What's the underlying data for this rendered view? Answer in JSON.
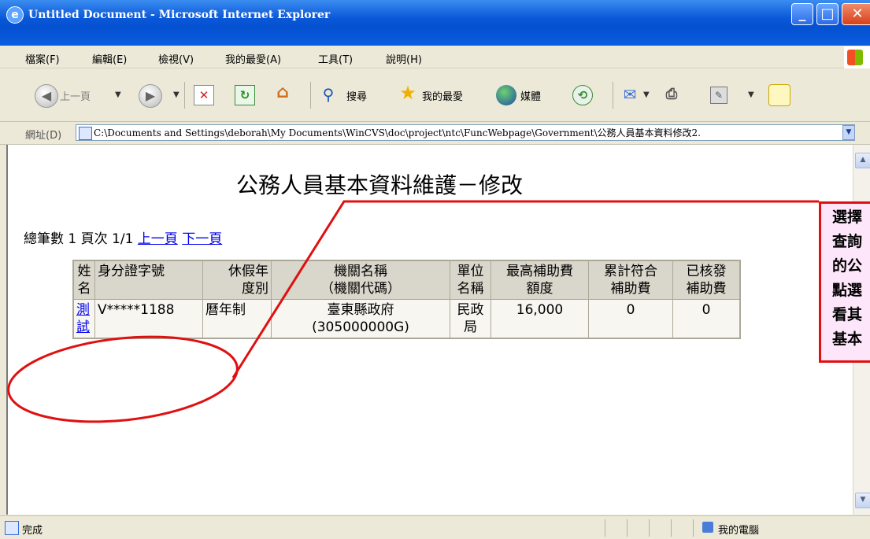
{
  "window": {
    "title": "Untitled Document - Microsoft Internet Explorer"
  },
  "menu": [
    "檔案(F)",
    "編輯(E)",
    "檢視(V)",
    "我的最愛(A)",
    "工具(T)",
    "說明(H)"
  ],
  "toolbar": {
    "back_label": "上一頁",
    "search_label": "搜尋",
    "favorites_label": "我的最愛",
    "media_label": "媒體"
  },
  "address": {
    "label": "網址(D)",
    "url": "C:\\Documents and Settings\\deborah\\My Documents\\WinCVS\\doc\\project\\ntc\\FuncWebpage\\Government\\公務人員基本資料修改2."
  },
  "page": {
    "title": "公務人員基本資料維護－修改",
    "summary": "總筆數 1 頁次 1/1",
    "prev_link": "上一頁",
    "next_link": "下一頁"
  },
  "table": {
    "headers": [
      "姓名",
      "身分證字號",
      "休假年度別",
      "機關名稱（機關代碼）",
      "單位名稱",
      "最高補助費額度",
      "累計符合補助費",
      "已核發補助費"
    ],
    "header_lines": [
      [
        "姓",
        "名"
      ],
      [
        "身分證字號"
      ],
      [
        "休假年",
        "度別"
      ],
      [
        "機關名稱",
        "（機關代碼）"
      ],
      [
        "單位",
        "名稱"
      ],
      [
        "最高補助費",
        "額度"
      ],
      [
        "累計符合",
        "補助費"
      ],
      [
        "已核發",
        "補助費"
      ]
    ],
    "rows": [
      {
        "name_lines": [
          "測",
          "試"
        ],
        "id": "V*****1188",
        "year_type": "曆年制",
        "agency_lines": [
          "臺東縣政府",
          "(305000000G)"
        ],
        "unit_lines": [
          "民政",
          "局"
        ],
        "max": "16,000",
        "accum": "0",
        "issued": "0"
      }
    ]
  },
  "callout": {
    "lines": [
      "選擇",
      "查詢",
      "的公",
      "點選",
      "看其",
      "基本"
    ],
    "border_color": "#e01010",
    "bg_color": "#fde6fa"
  },
  "status": {
    "text": "完成",
    "zone": "我的電腦"
  }
}
